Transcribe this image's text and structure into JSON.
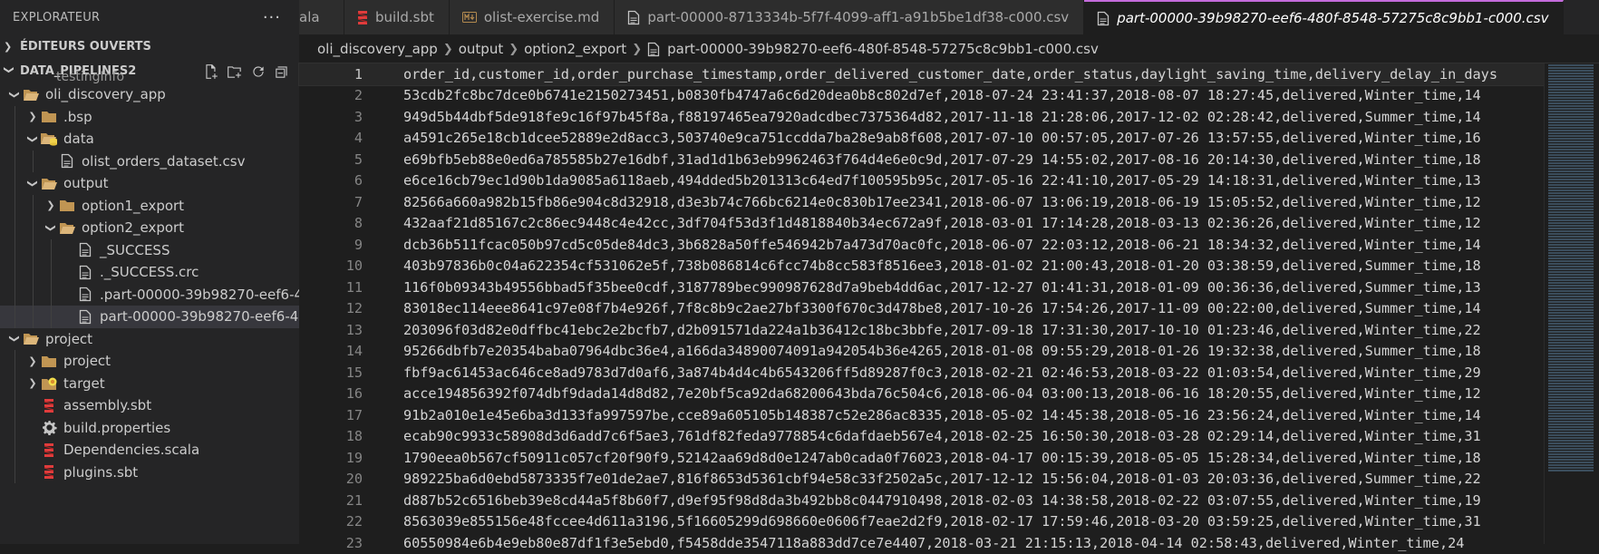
{
  "sidebar": {
    "title": "EXPLORATEUR",
    "more": "···",
    "open_editors": "ÉDITEURS OUVERTS",
    "workspace": "DATA_PIPELINES2",
    "partial_top": "testingInfo",
    "tree": [
      {
        "label": "oli_discovery_app",
        "icon": "folder-open-icon",
        "indent": 0,
        "twisty": "open"
      },
      {
        "label": ".bsp",
        "icon": "folder-icon",
        "indent": 1,
        "twisty": "closed"
      },
      {
        "label": "data",
        "icon": "folder-data-icon",
        "indent": 1,
        "twisty": "open"
      },
      {
        "label": "olist_orders_dataset.csv",
        "icon": "file-icon",
        "indent": 2,
        "twisty": "none"
      },
      {
        "label": "output",
        "icon": "folder-open-icon",
        "indent": 1,
        "twisty": "open"
      },
      {
        "label": "option1_export",
        "icon": "folder-icon",
        "indent": 2,
        "twisty": "closed"
      },
      {
        "label": "option2_export",
        "icon": "folder-open-icon",
        "indent": 2,
        "twisty": "open"
      },
      {
        "label": "_SUCCESS",
        "icon": "file-icon",
        "indent": 3,
        "twisty": "none"
      },
      {
        "label": "._SUCCESS.crc",
        "icon": "file-icon",
        "indent": 3,
        "twisty": "none"
      },
      {
        "label": ".part-00000-39b98270-eef6-48...",
        "icon": "file-icon",
        "indent": 3,
        "twisty": "none"
      },
      {
        "label": "part-00000-39b98270-eef6-480...",
        "icon": "file-icon",
        "indent": 3,
        "twisty": "none",
        "selected": true
      },
      {
        "label": "project",
        "icon": "folder-open-icon",
        "indent": 0,
        "twisty": "open"
      },
      {
        "label": "project",
        "icon": "folder-icon",
        "indent": 1,
        "twisty": "closed"
      },
      {
        "label": "target",
        "icon": "folder-target-icon",
        "indent": 1,
        "twisty": "closed"
      },
      {
        "label": "assembly.sbt",
        "icon": "sbt-icon",
        "indent": 1,
        "twisty": "none"
      },
      {
        "label": "build.properties",
        "icon": "gear-icon",
        "indent": 1,
        "twisty": "none"
      },
      {
        "label": "Dependencies.scala",
        "icon": "scala-icon",
        "indent": 1,
        "twisty": "none"
      },
      {
        "label": "plugins.sbt",
        "icon": "sbt-icon",
        "indent": 1,
        "twisty": "none"
      }
    ]
  },
  "tabs": [
    {
      "label": "ala",
      "icon": ""
    },
    {
      "label": "build.sbt",
      "icon": "sbt-icon"
    },
    {
      "label": "olist-exercise.md",
      "icon": "markdown-icon"
    },
    {
      "label": "part-00000-8713334b-5f7f-4099-aff1-a91b5be1df38-c000.csv",
      "icon": "file-icon"
    },
    {
      "label": "part-00000-39b98270-eef6-480f-8548-57275c8c9bb1-c000.csv",
      "icon": "file-icon",
      "active": true
    }
  ],
  "breadcrumb": [
    "oli_discovery_app",
    "output",
    "option2_export",
    "part-00000-39b98270-eef6-480f-8548-57275c8c9bb1-c000.csv"
  ],
  "lines": [
    "order_id,customer_id,order_purchase_timestamp,order_delivered_customer_date,order_status,daylight_saving_time,delivery_delay_in_days",
    "53cdb2fc8bc7dce0b6741e2150273451,b0830fb4747a6c6d20dea0b8c802d7ef,2018-07-24 23:41:37,2018-08-07 18:27:45,delivered,Winter_time,14",
    "949d5b44dbf5de918fe9c16f97b45f8a,f88197465ea7920adcdbec7375364d82,2017-11-18 21:28:06,2017-12-02 02:28:42,delivered,Summer_time,14",
    "a4591c265e18cb1dcee52889e2d8acc3,503740e9ca751ccdda7ba28e9ab8f608,2017-07-10 00:57:05,2017-07-26 13:57:55,delivered,Winter_time,16",
    "e69bfb5eb88e0ed6a785585b27e16dbf,31ad1d1b63eb9962463f764d4e6e0c9d,2017-07-29 14:55:02,2017-08-16 20:14:30,delivered,Winter_time,18",
    "e6ce16cb79ec1d90b1da9085a6118aeb,494dded5b201313c64ed7f100595b95c,2017-05-16 22:41:10,2017-05-29 14:18:31,delivered,Winter_time,13",
    "82566a660a982b15fb86e904c8d32918,d3e3b74c766bc6214e0c830b17ee2341,2018-06-07 13:06:19,2018-06-19 15:05:52,delivered,Winter_time,12",
    "432aaf21d85167c2c86ec9448c4e42cc,3df704f53d3f1d4818840b34ec672a9f,2018-03-01 17:14:28,2018-03-13 02:36:26,delivered,Winter_time,12",
    "dcb36b511fcac050b97cd5c05de84dc3,3b6828a50ffe546942b7a473d70ac0fc,2018-06-07 22:03:12,2018-06-21 18:34:32,delivered,Winter_time,14",
    "403b97836b0c04a622354cf531062e5f,738b086814c6fcc74b8cc583f8516ee3,2018-01-02 21:00:43,2018-01-20 03:38:59,delivered,Summer_time,18",
    "116f0b09343b49556bbad5f35bee0cdf,3187789bec990987628d7a9beb4dd6ac,2017-12-27 01:41:31,2018-01-09 00:36:36,delivered,Summer_time,13",
    "83018ec114eee8641c97e08f7b4e926f,7f8c8b9c2ae27bf3300f670c3d478be8,2017-10-26 17:54:26,2017-11-09 00:22:00,delivered,Summer_time,14",
    "203096f03d82e0dffbc41ebc2e2bcfb7,d2b091571da224a1b36412c18bc3bbfe,2017-09-18 17:31:30,2017-10-10 01:23:46,delivered,Winter_time,22",
    "95266dbfb7e20354baba07964dbc36e4,a166da34890074091a942054b36e4265,2018-01-08 09:55:29,2018-01-26 19:32:38,delivered,Summer_time,18",
    "fbf9ac61453ac646ce8ad9783d7d0af6,3a874b4d4c4b6543206ff5d89287f0c3,2018-02-21 02:46:53,2018-03-22 01:03:54,delivered,Winter_time,29",
    "acce194856392f074dbf9dada14d8d82,7e20bf5ca92da68200643bda76c504c6,2018-06-04 03:00:13,2018-06-16 18:20:55,delivered,Winter_time,12",
    "91b2a010e1e45e6ba3d133fa997597be,cce89a605105b148387c52e286ac8335,2018-05-02 14:45:38,2018-05-16 23:56:24,delivered,Winter_time,14",
    "ecab90c9933c58908d3d6add7c6f5ae3,761df82feda9778854c6dafdaeb567e4,2018-02-25 16:50:30,2018-03-28 02:29:14,delivered,Winter_time,31",
    "1790eea0b567cf50911c057cf20f90f9,52142aa69d8d0e1247ab0cada0f76023,2018-04-17 00:15:39,2018-05-05 15:28:34,delivered,Winter_time,18",
    "989225ba6d0ebd5873335f7e01de2ae7,816f8653d5361cbf94e58c33f2502a5c,2017-12-12 15:56:04,2018-01-03 20:03:36,delivered,Summer_time,22",
    "d887b52c6516beb39e8cd44a5f8b60f7,d9ef95f98d8da3b492bb8c0447910498,2018-02-03 14:38:58,2018-02-22 03:07:55,delivered,Winter_time,19",
    "8563039e855156e48fccee4d611a3196,5f16605299d698660e0606f7eae2d2f9,2018-02-17 17:59:46,2018-03-20 03:59:25,delivered,Winter_time,31",
    "60550984e6b4e9eb80e87df1f3e5ebd0,f5458dde3547118a883dd7ce7e4407,2018-03-21 21:15:13,2018-04-14 02:58:43,delivered,Winter_time,24"
  ]
}
